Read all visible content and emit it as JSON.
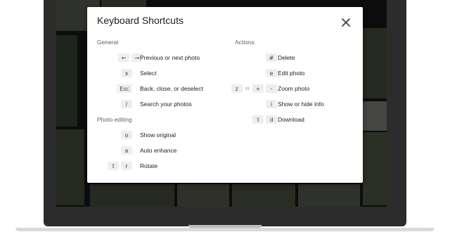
{
  "dialog": {
    "title": "Keyboard Shortcuts",
    "close_icon": "close-icon"
  },
  "general": {
    "title": "General",
    "rows": [
      {
        "keys": [
          "←",
          "→"
        ],
        "label": "Previous or next photo"
      },
      {
        "keys": [
          "x"
        ],
        "label": "Select"
      },
      {
        "keys": [
          "Esc"
        ],
        "label": "Back, close, or deselect"
      },
      {
        "keys": [
          "/"
        ],
        "label": "Search your photos"
      }
    ]
  },
  "photo_editing": {
    "title": "Photo editing",
    "rows": [
      {
        "keys": [
          "o"
        ],
        "label": "Show original"
      },
      {
        "keys": [
          "a"
        ],
        "label": "Auto enhance"
      },
      {
        "keys": [
          "⇧",
          "r"
        ],
        "label": "Rotate"
      }
    ]
  },
  "actions": {
    "title": "Actions",
    "rows": [
      {
        "keys": [
          "#"
        ],
        "label": "Delete"
      },
      {
        "keys": [
          "e"
        ],
        "label": "Edit photo"
      },
      {
        "keys": [
          "z",
          "or",
          "+",
          "-"
        ],
        "label": "Zoom photo"
      },
      {
        "keys": [
          "i"
        ],
        "label": "Show or hide info"
      },
      {
        "keys": [
          "⇧",
          "d"
        ],
        "label": "Download"
      }
    ]
  },
  "colors": {
    "dialog_bg": "#ffffff",
    "key_bg": "#eeeeee",
    "frame": "#2c2c2c"
  }
}
